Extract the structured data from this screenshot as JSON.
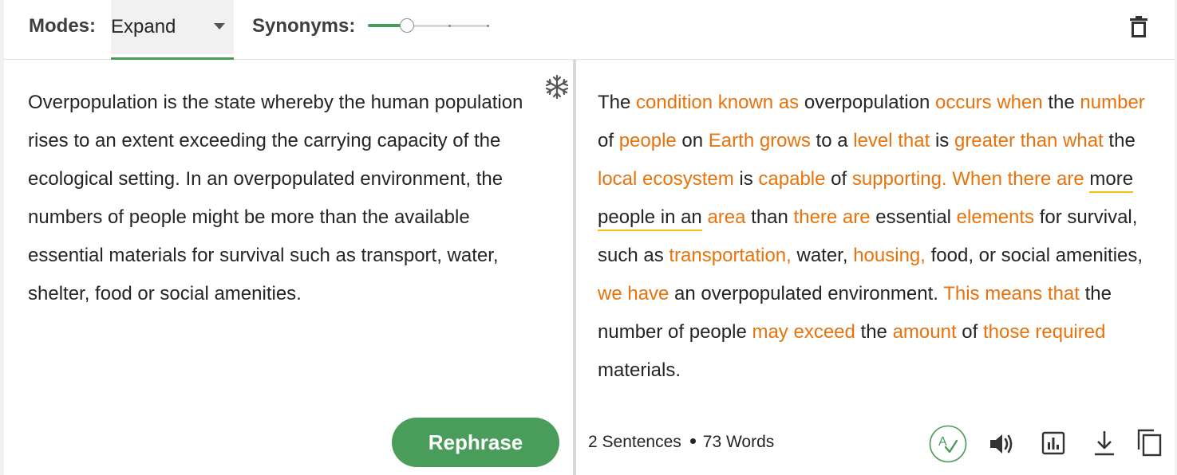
{
  "toolbar": {
    "modes_label": "Modes:",
    "mode_value": "Expand",
    "synonyms_label": "Synonyms:",
    "synonyms_level": 0.33
  },
  "input": {
    "text": "Overpopulation is the state whereby the human population rises to an extent exceeding the carrying capacity of the ecological setting. In an overpopulated environment, the numbers of people might be more than the available essential materials for survival such as transport, water, shelter, food or social amenities."
  },
  "actions": {
    "rephrase_label": "Rephrase"
  },
  "output": {
    "segments": [
      {
        "text": "The ",
        "changed": false
      },
      {
        "text": "condition known as",
        "changed": true
      },
      {
        "text": " overpopulation ",
        "changed": false
      },
      {
        "text": "occurs when",
        "changed": true
      },
      {
        "text": " the ",
        "changed": false
      },
      {
        "text": "number",
        "changed": true
      },
      {
        "text": " of ",
        "changed": false
      },
      {
        "text": "people",
        "changed": true
      },
      {
        "text": " on ",
        "changed": false
      },
      {
        "text": "Earth grows",
        "changed": true
      },
      {
        "text": " to a ",
        "changed": false
      },
      {
        "text": "level that",
        "changed": true
      },
      {
        "text": " is ",
        "changed": false
      },
      {
        "text": "greater than what",
        "changed": true
      },
      {
        "text": " the ",
        "changed": false
      },
      {
        "text": "local ecosystem",
        "changed": true
      },
      {
        "text": " is ",
        "changed": false
      },
      {
        "text": "capable",
        "changed": true
      },
      {
        "text": " of ",
        "changed": false
      },
      {
        "text": "supporting. When there are",
        "changed": true
      },
      {
        "text": " ",
        "changed": false
      },
      {
        "text": "more people in an",
        "changed": false,
        "flagged": true
      },
      {
        "text": " ",
        "changed": false
      },
      {
        "text": "area",
        "changed": true
      },
      {
        "text": " than ",
        "changed": false
      },
      {
        "text": "there are",
        "changed": true
      },
      {
        "text": " essential ",
        "changed": false
      },
      {
        "text": "elements",
        "changed": true
      },
      {
        "text": " for survival, such as ",
        "changed": false
      },
      {
        "text": "transportation,",
        "changed": true
      },
      {
        "text": " water, ",
        "changed": false
      },
      {
        "text": "housing,",
        "changed": true
      },
      {
        "text": " food, or social amenities, ",
        "changed": false
      },
      {
        "text": "we have",
        "changed": true
      },
      {
        "text": " an overpopulated environment. ",
        "changed": false
      },
      {
        "text": "This means that",
        "changed": true
      },
      {
        "text": " the number of people ",
        "changed": false
      },
      {
        "text": "may exceed",
        "changed": true
      },
      {
        "text": " the ",
        "changed": false
      },
      {
        "text": "amount",
        "changed": true
      },
      {
        "text": " of ",
        "changed": false
      },
      {
        "text": "those required",
        "changed": true
      },
      {
        "text": " materials.",
        "changed": false
      }
    ]
  },
  "stats": {
    "sentences": "2 Sentences",
    "words": "73 Words"
  },
  "icons": {
    "trash": "trash-icon",
    "freeze": "freeze-snowflake-icon",
    "grammar": "grammar-check-icon",
    "speaker": "speaker-icon",
    "chart": "bar-chart-icon",
    "download": "download-icon",
    "copy": "copy-icon"
  },
  "colors": {
    "accent": "#4a9c5a",
    "changed_word": "#e8730c",
    "flag_underline": "#f2c10f"
  }
}
